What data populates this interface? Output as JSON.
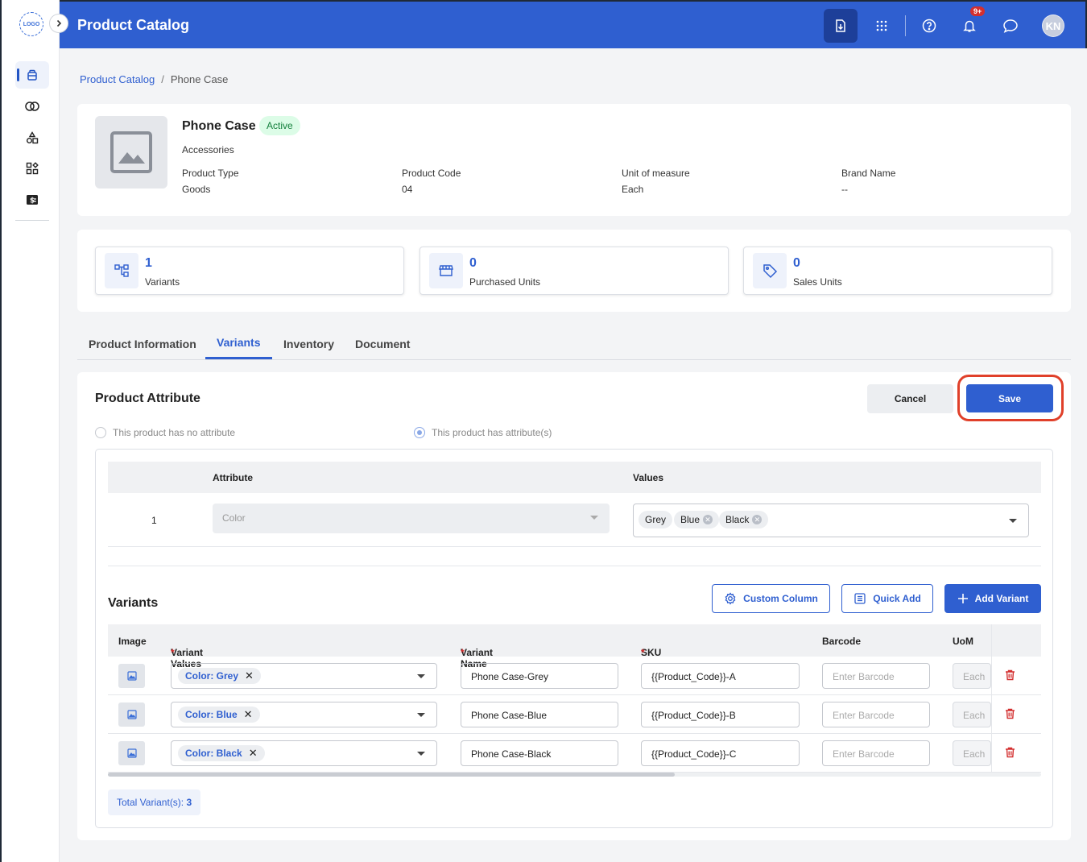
{
  "app": {
    "title": "Product Catalog",
    "logo_text": "LOGO",
    "avatar_initials": "KN",
    "notification_badge": "9+"
  },
  "sidebar": {
    "items": [
      {
        "name": "catalog-icon",
        "active": true
      },
      {
        "name": "rings-icon"
      },
      {
        "name": "shapes-icon"
      },
      {
        "name": "widgets-icon"
      },
      {
        "name": "dollar-icon"
      }
    ]
  },
  "breadcrumb": {
    "parent": "Product Catalog",
    "separator": "/",
    "current": "Phone Case"
  },
  "product": {
    "name": "Phone Case",
    "status": "Active",
    "category": "Accessories",
    "fields": [
      {
        "label": "Product Type",
        "value": "Goods"
      },
      {
        "label": "Product Code",
        "value": "04"
      },
      {
        "label": "Unit of measure",
        "value": "Each"
      },
      {
        "label": "Brand Name",
        "value": "--"
      }
    ]
  },
  "stats": [
    {
      "value": "1",
      "label": "Variants"
    },
    {
      "value": "0",
      "label": "Purchased Units"
    },
    {
      "value": "0",
      "label": "Sales Units"
    }
  ],
  "tabs": [
    {
      "label": "Product Information"
    },
    {
      "label": "Variants",
      "active": true
    },
    {
      "label": "Inventory"
    },
    {
      "label": "Document"
    }
  ],
  "attribute_section": {
    "title": "Product Attribute",
    "cancel_label": "Cancel",
    "save_label": "Save",
    "radio_no_attr": "This product has no attribute",
    "radio_has_attr": "This product has attribute(s)",
    "selected_radio": "has_attr",
    "table_headers": {
      "attribute": "Attribute",
      "values": "Values"
    },
    "rows": [
      {
        "index": "1",
        "attribute_placeholder": "Color",
        "values": [
          "Grey",
          "Blue",
          "Black"
        ]
      }
    ]
  },
  "variants_section": {
    "title": "Variants",
    "custom_column_label": "Custom Column",
    "quick_add_label": "Quick Add",
    "add_variant_label": "Add Variant",
    "headers": {
      "image": "Image",
      "variant_values": "Variant Values",
      "variant_name": "Variant Name",
      "sku": "SKU",
      "barcode": "Barcode",
      "uom": "UoM",
      "required_mark": "*"
    },
    "rows": [
      {
        "chip": "Color: Grey",
        "name": "Phone Case-Grey",
        "sku": "{{Product_Code}}-A",
        "barcode_placeholder": "Enter Barcode",
        "uom": "Each"
      },
      {
        "chip": "Color: Blue",
        "name": "Phone Case-Blue",
        "sku": "{{Product_Code}}-B",
        "barcode_placeholder": "Enter Barcode",
        "uom": "Each"
      },
      {
        "chip": "Color: Black",
        "name": "Phone Case-Black",
        "sku": "{{Product_Code}}-C",
        "barcode_placeholder": "Enter Barcode",
        "uom": "Each"
      }
    ],
    "total_label": "Total Variant(s):",
    "total_count": "3"
  },
  "colors": {
    "primary": "#2f5fd0",
    "highlight": "#e0402a",
    "active_green": "#15803d",
    "danger": "#d32f2f"
  }
}
